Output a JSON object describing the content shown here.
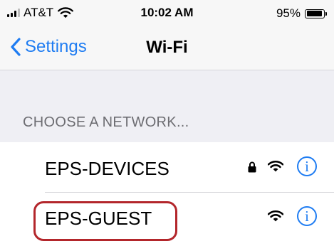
{
  "status_bar": {
    "carrier": "AT&T",
    "time": "10:02 AM",
    "battery_percent": "95%",
    "battery_level": 0.95,
    "signal_bars_filled": 3,
    "signal_bars_total": 4
  },
  "nav": {
    "back_label": "Settings",
    "title": "Wi-Fi"
  },
  "section": {
    "header": "CHOOSE A NETWORK..."
  },
  "networks": [
    {
      "name": "EPS-DEVICES",
      "secured": true,
      "icons": [
        "lock-icon",
        "wifi-icon",
        "info-icon"
      ]
    },
    {
      "name": "EPS-GUEST",
      "secured": false,
      "highlighted": true,
      "icons": [
        "wifi-icon",
        "info-icon"
      ]
    }
  ],
  "info_glyph": "i",
  "colors": {
    "accent": "#1e7cf2",
    "highlight": "#b3262b",
    "group_background": "#efeff4",
    "bar_background": "#f7f7f7"
  }
}
